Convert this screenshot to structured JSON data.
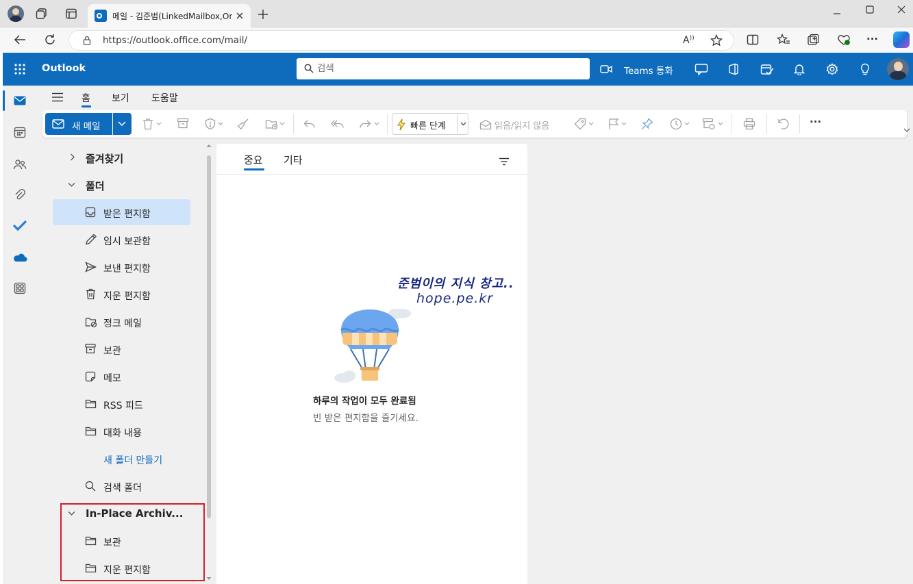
{
  "browser": {
    "tab_title": "메일 - 김준범(LinkedMailbox,Onl",
    "url": "https://outlook.office.com/mail/"
  },
  "header": {
    "app_name": "Outlook",
    "search_placeholder": "검색",
    "teams_call": "Teams 통화",
    "brand_color": "#0f6cbd"
  },
  "ribbon_tabs": [
    "홈",
    "보기",
    "도움말"
  ],
  "toolbar": {
    "new_mail": "새 메일",
    "quick_steps": "빠른 단계",
    "read_unread": "읽음/읽지 않음",
    "more": "···"
  },
  "folders": {
    "favorites": "즐겨찾기",
    "folders": "폴더",
    "items": [
      {
        "name": "받은 편지함",
        "icon": "inbox-icon",
        "selected": true
      },
      {
        "name": "임시 보관함",
        "icon": "pencil-icon"
      },
      {
        "name": "보낸 편지함",
        "icon": "send-icon"
      },
      {
        "name": "지운 편지함",
        "icon": "trash-icon"
      },
      {
        "name": "정크 메일",
        "icon": "junk-folder-icon"
      },
      {
        "name": "보관",
        "icon": "archive-icon"
      },
      {
        "name": "메모",
        "icon": "note-icon"
      },
      {
        "name": "RSS 피드",
        "icon": "folder-icon"
      },
      {
        "name": "대화 내용",
        "icon": "folder-icon"
      }
    ],
    "new_folder": "새 폴더 만들기",
    "search_folder": "검색 폴더",
    "archive_group": "In-Place Archiv...",
    "archive_items": [
      "보관",
      "지운 편지함"
    ]
  },
  "message_list": {
    "tab_focused": "중요",
    "tab_other": "기타",
    "empty_title": "하루의 작업이 모두 완료됨",
    "empty_subtitle": "빈 받은 편지함을 즐기세요."
  },
  "watermark": {
    "line1": "준범이의 지식 창고..",
    "line2": "hope.pe.kr"
  }
}
